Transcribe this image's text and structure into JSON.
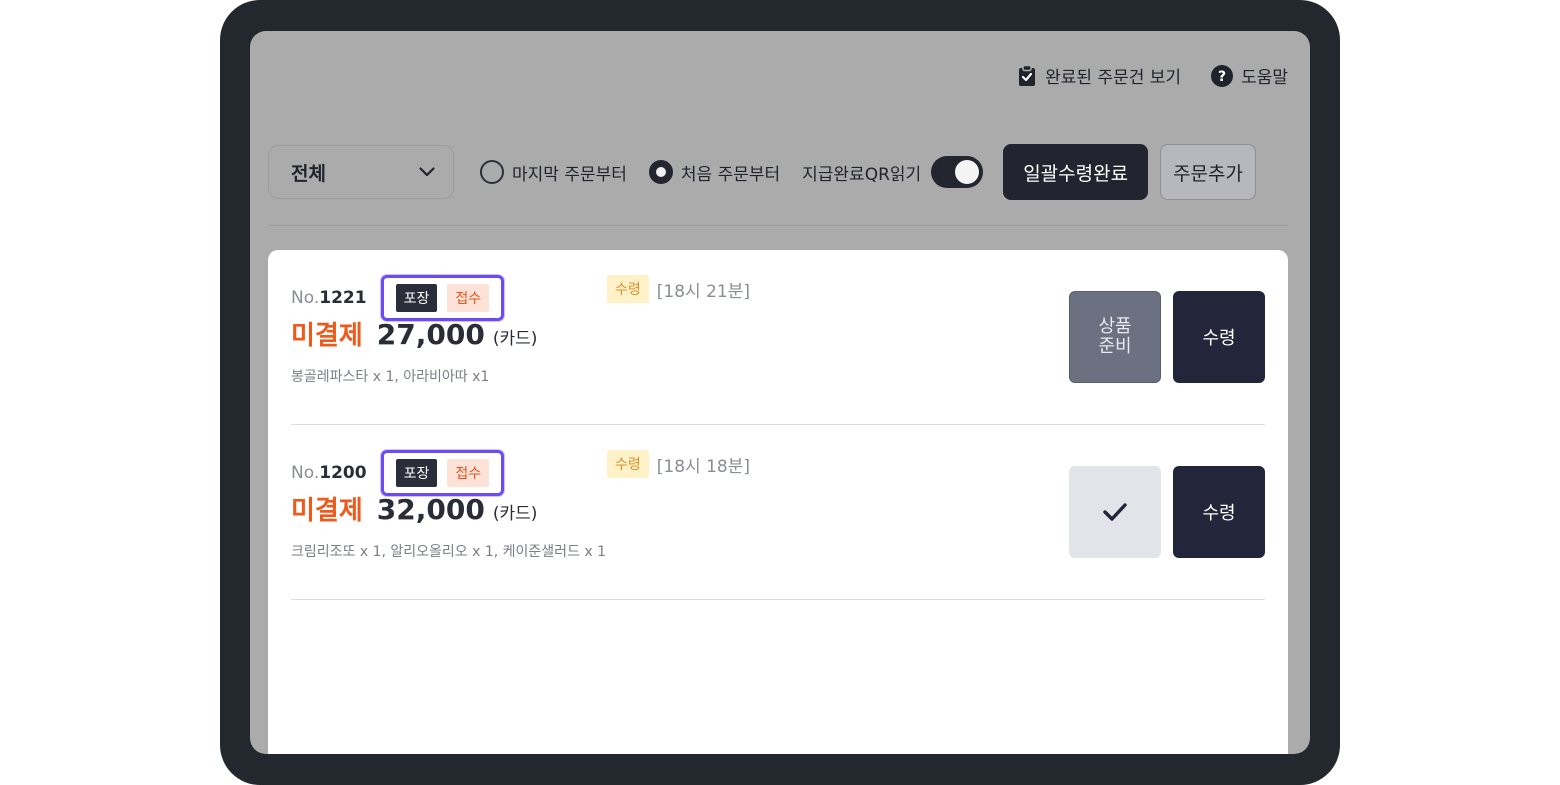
{
  "header": {
    "completed_orders_link": "완료된 주문건 보기",
    "help_link": "도움말"
  },
  "filters": {
    "select_value": "전체",
    "radio_last": "마지막 주문부터",
    "radio_first": "처음 주문부터",
    "qr_toggle_label": "지급완료QR읽기",
    "qr_toggle_on": true,
    "bulk_pickup_button": "일괄수령완료",
    "add_order_button": "주문추가"
  },
  "orders": [
    {
      "no_prefix": "No.",
      "no": "1221",
      "tag_type": "포장",
      "tag_status": "접수",
      "pickup_tag": "수령",
      "pickup_time": "[18시 21분]",
      "payment_status": "미결제",
      "amount": "27,000",
      "payment_method": "(카드)",
      "items": "봉골레파스타 x 1, 아라비아따 x1",
      "prep_button_line1": "상품",
      "prep_button_line2": "준비",
      "pickup_button": "수령"
    },
    {
      "no_prefix": "No.",
      "no": "1200",
      "tag_type": "포장",
      "tag_status": "접수",
      "pickup_tag": "수령",
      "pickup_time": "[18시 18분]",
      "payment_status": "미결제",
      "amount": "32,000",
      "payment_method": "(카드)",
      "items": "크림리조또 x 1, 알리오올리오 x 1, 케이준샐러드 x 1",
      "check_button_icon": "checkmark-icon",
      "pickup_button": "수령"
    }
  ],
  "colors": {
    "accent_dark": "#22252f",
    "unpaid_orange": "#ee5a1c",
    "highlight_purple": "#6b4bf3"
  }
}
